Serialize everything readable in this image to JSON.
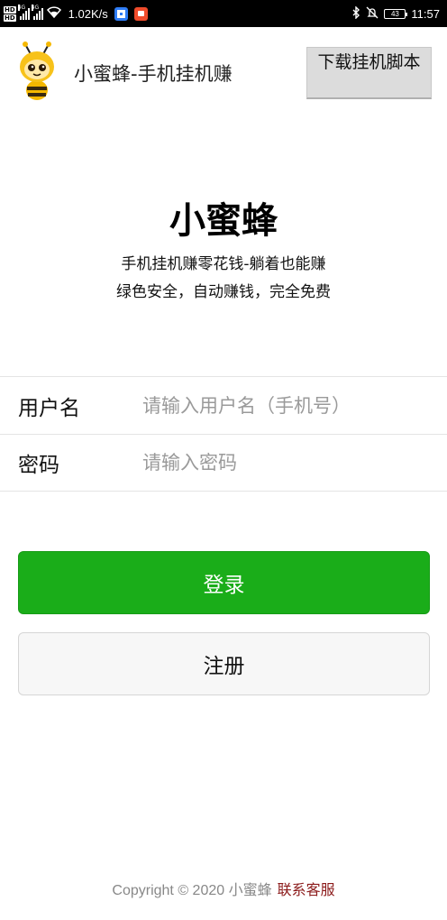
{
  "status_bar": {
    "hd_badges": [
      "HD",
      "HD"
    ],
    "network_1": "4G",
    "network_2": "4G",
    "net_speed": "1.02K/s",
    "battery_level": "43",
    "time": "11:57",
    "icons": [
      "hd-icon",
      "signal-icon",
      "wifi-icon",
      "shield-app-icon",
      "red-app-icon",
      "bluetooth-icon",
      "mute-icon",
      "battery-icon"
    ]
  },
  "header": {
    "app_title": "小蜜蜂-手机挂机赚",
    "download_button": "下载挂机脚本",
    "logo_icon": "bee-logo-icon"
  },
  "hero": {
    "title": "小蜜蜂",
    "subtitle_line1": "手机挂机赚零花钱-躺着也能赚",
    "subtitle_line2": "绿色安全，自动赚钱，完全免费"
  },
  "form": {
    "username_label": "用户名",
    "username_placeholder": "请输入用户名（手机号）",
    "username_value": "",
    "password_label": "密码",
    "password_placeholder": "请输入密码",
    "password_value": ""
  },
  "buttons": {
    "login": "登录",
    "register": "注册"
  },
  "footer": {
    "copyright": "Copyright © 2020 小蜜蜂",
    "contact_link": "联系客服"
  },
  "colors": {
    "login_green": "#1aad19",
    "contact_red": "#8b1a1a",
    "download_bg": "#dcdcdc"
  }
}
